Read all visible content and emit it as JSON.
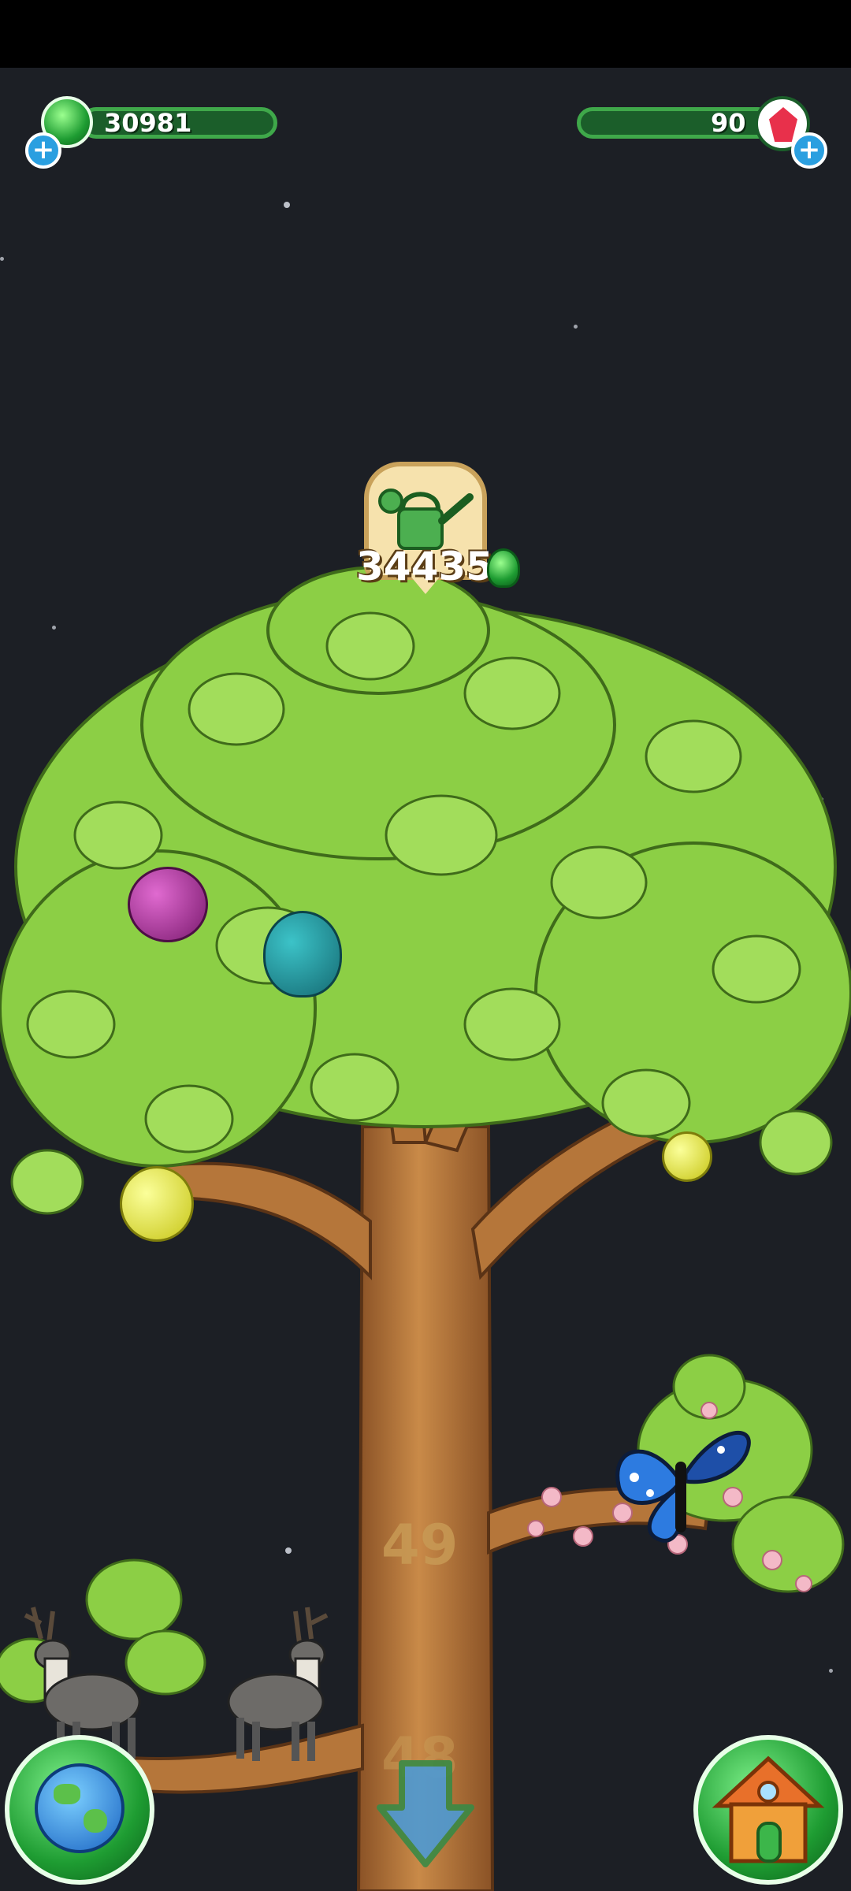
{
  "hud": {
    "gems": {
      "value": "30981",
      "icon": "green-gem-icon",
      "add_icon": "plus-icon"
    },
    "crystals": {
      "value": "90",
      "icon": "red-crystal-icon",
      "add_icon": "plus-icon"
    }
  },
  "upgrade": {
    "icon": "watering-can-icon",
    "cost": "34435",
    "currency_icon": "green-gem-icon"
  },
  "tree": {
    "levels": [
      "49",
      "48"
    ]
  },
  "buttons": {
    "world": {
      "icon": "globe-icon"
    },
    "home": {
      "icon": "house-icon"
    },
    "scroll_down": {
      "icon": "down-arrow-icon"
    }
  },
  "colors": {
    "accent": "#3fa84a",
    "leaf": "#8ccf45",
    "trunk": "#b5763a",
    "sky": "#1c1f25"
  }
}
